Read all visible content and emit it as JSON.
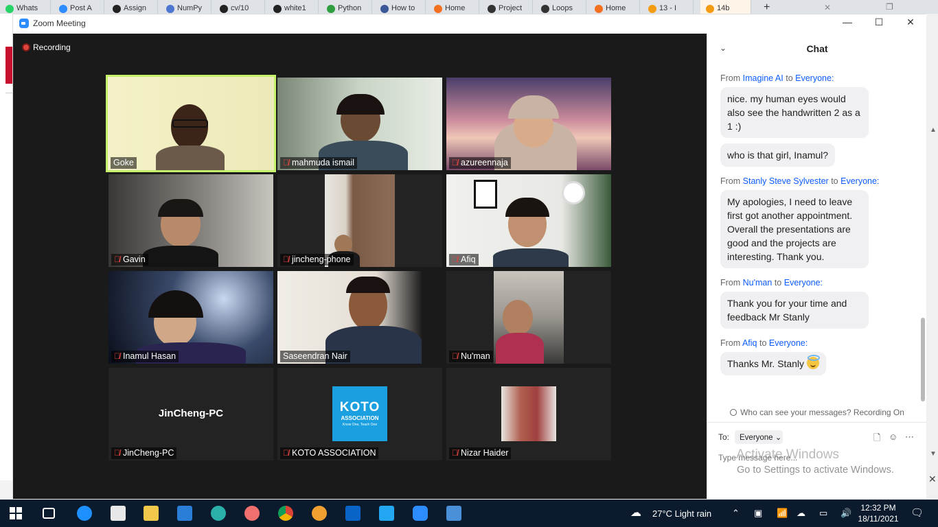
{
  "browser": {
    "tabs": [
      "Whats",
      "Post A",
      "Assign",
      "NumPy",
      "cv/10",
      "white1",
      "Python",
      "How to",
      "Home",
      "Project",
      "Loops",
      "Home",
      "13 - I",
      "14b"
    ]
  },
  "window": {
    "title": "Zoom Meeting",
    "recording_label": "Recording"
  },
  "participants": [
    {
      "name": "Goke",
      "muted": false,
      "speaking": true
    },
    {
      "name": "mahmuda ismail",
      "muted": true
    },
    {
      "name": "azureennaja",
      "muted": true
    },
    {
      "name": "Gavin",
      "muted": true
    },
    {
      "name": "jincheng-phone",
      "muted": true
    },
    {
      "name": "Afiq",
      "muted": true
    },
    {
      "name": "Inamul Hasan",
      "muted": true
    },
    {
      "name": "Saseendran Nair",
      "muted": false
    },
    {
      "name": "Nu'man",
      "muted": true
    },
    {
      "name": "JinCheng-PC",
      "muted": true,
      "display_name": "JinCheng-PC"
    },
    {
      "name": "KOTO ASSOCIATION",
      "muted": true
    },
    {
      "name": "Nizar Haider",
      "muted": true
    }
  ],
  "koto_logo": {
    "line1": "KOTO",
    "line2": "ASSOCIATION",
    "line3": "Know One, Teach One"
  },
  "chat": {
    "title": "Chat",
    "messages": [
      {
        "prefix": "From",
        "from": "Imagine AI",
        "to_word": "to",
        "to": "Everyone:",
        "texts": [
          "nice. my human eyes would also see the handwritten 2 as a 1 :)",
          "who is that girl, Inamul?"
        ]
      },
      {
        "prefix": "From",
        "from": "Stanly Steve Sylvester",
        "to_word": "to",
        "to": "Everyone:",
        "texts": [
          "My apologies, I need to leave first got another appointment. Overall the presentations are good and the projects are interesting. Thank you."
        ]
      },
      {
        "prefix": "From",
        "from": "Nu'man",
        "to_word": "to",
        "to": "Everyone:",
        "texts": [
          "Thank you for your time and feedback Mr Stanly"
        ]
      },
      {
        "prefix": "From",
        "from": "Afiq",
        "to_word": "to",
        "to": "Everyone:",
        "texts": [
          "Thanks Mr. Stanly"
        ]
      }
    ],
    "visibility": "Who can see your messages? Recording On",
    "to_label": "To:",
    "to_value": "Everyone",
    "input_placeholder": "Type message here..."
  },
  "activation": {
    "line1": "Activate Windows",
    "line2": "Go to Settings to activate Windows."
  },
  "taskbar": {
    "weather": "27°C  Light rain",
    "time": "12:32 PM",
    "date": "18/11/2021"
  }
}
